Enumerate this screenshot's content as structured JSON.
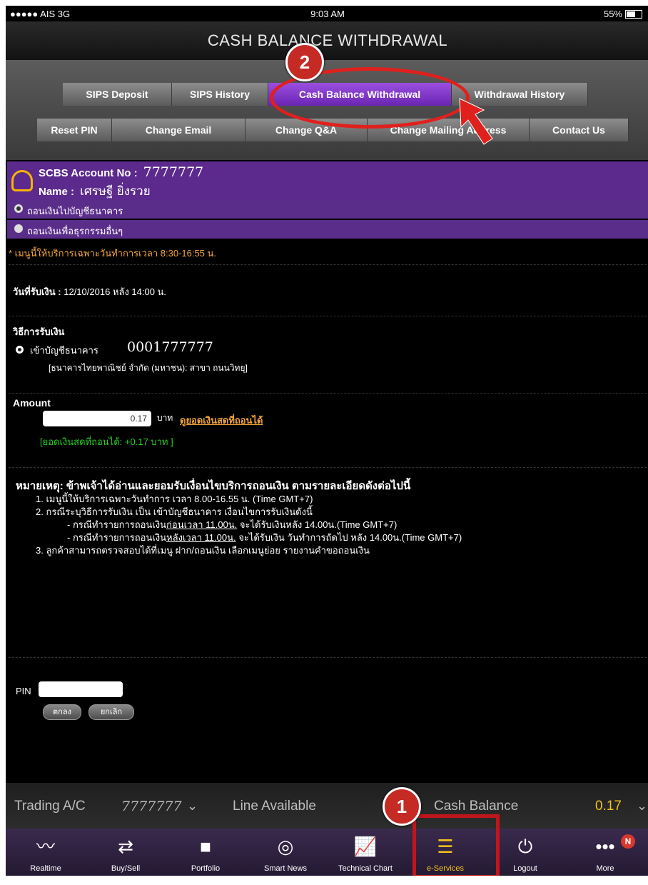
{
  "status": {
    "carrier": "●●●●● AIS  3G",
    "time": "9:03 AM",
    "battery": "55%"
  },
  "title": "CASH BALANCE WITHDRAWAL",
  "menu_row1": [
    "SIPS Deposit",
    "SIPS History",
    "Cash Balance Withdrawal",
    "Withdrawal History"
  ],
  "menu_row2": [
    "Reset PIN",
    "Change Email",
    "Change Q&A",
    "Change Mailing Address",
    "Contact Us"
  ],
  "annotations": {
    "step1": "1",
    "step2": "2"
  },
  "account": {
    "no_label": "SCBS Account No :",
    "no_value": "7777777",
    "name_label": "Name :",
    "name_value": "เศรษฐี ยิ่งรวย"
  },
  "options": [
    "ถอนเงินไปบัญชีธนาคาร",
    "ถอนเงินเพื่อธุรกรรมอื่นๆ"
  ],
  "service_notice": "* เมนูนี้ให้บริการเฉพาะวันทำการเวลา 8:30-16:55 น.",
  "receive_date": {
    "label": "วันที่รับเงิน :",
    "value": "12/10/2016 หลัง 14:00 น."
  },
  "method": {
    "label": "วิธีการรับเงิน",
    "option": "เข้าบัญชีธนาคาร",
    "account": "0001777777",
    "bank": "[ธนาคารไทยพาณิชย์ จำกัด (มหาชน): สาขา ถนนวิทยุ]"
  },
  "amount": {
    "label": "Amount",
    "value": "0.17",
    "unit": "บาท",
    "link": "ดูยอดเงินสดที่ถอนได้",
    "available": "[ยอดเงินสดที่ถอนได้: +0.17 บาท ]"
  },
  "remarks": {
    "head": "หมายเหตุ: ข้าพเจ้าได้อ่านและยอมรับเงื่อนไขบริการถอนเงิน ตามรายละเอียดดังต่อไปนี้",
    "item1": "1. เมนูนี้ให้บริการเฉพาะวันทำการ เวลา 8.00-16.55 น. (Time GMT+7)",
    "item2": "2. กรณีระบุวิธีการรับเงิน เป็น เข้าบัญชีธนาคาร เงื่อนไขการรับเงินดังนี้",
    "item2a_pre": "- กรณีทำรายการถอนเงิน",
    "item2a_u": "ก่อนเวลา 11.00น.",
    "item2a_post": " จะได้รับเงินหลัง 14.00น.(Time GMT+7)",
    "item2b_pre": "- กรณีทำรายการถอนเงิน",
    "item2b_u": "หลังเวลา 11.00น.",
    "item2b_post": " จะได้รับเงิน วันทำการถัดไป หลัง 14.00น.(Time GMT+7)",
    "item3": "3. ลูกค้าสามารถตรวจสอบได้ที่เมนู ฝาก/ถอนเงิน เลือกเมนูย่อย รายงานคำขอถอนเงิน"
  },
  "pin": {
    "label": "PIN",
    "ok": "ตกลง",
    "cancel": "ยกเลิก"
  },
  "trading": {
    "label": "Trading A/C",
    "account": "7777777",
    "line": "Line Available",
    "cash_label": "Cash Balance",
    "cash_value": "0.17"
  },
  "tabs": [
    {
      "label": "Realtime",
      "icon": "realtime-icon"
    },
    {
      "label": "Buy/Sell",
      "icon": "buy-sell-icon"
    },
    {
      "label": "Portfolio",
      "icon": "folder-icon"
    },
    {
      "label": "Smart News",
      "icon": "compass-icon"
    },
    {
      "label": "Technical Chart",
      "icon": "chart-icon"
    },
    {
      "label": "e-Services",
      "icon": "e-services-icon"
    },
    {
      "label": "Logout",
      "icon": "power-icon"
    },
    {
      "label": "More",
      "icon": "more-icon"
    }
  ],
  "more_badge": "N",
  "colors": {
    "accent": "#6a25b2",
    "notice": "#f2a53a",
    "positive": "#25d025",
    "annotation": "#c62a24",
    "active_tab": "#f4c01e"
  }
}
